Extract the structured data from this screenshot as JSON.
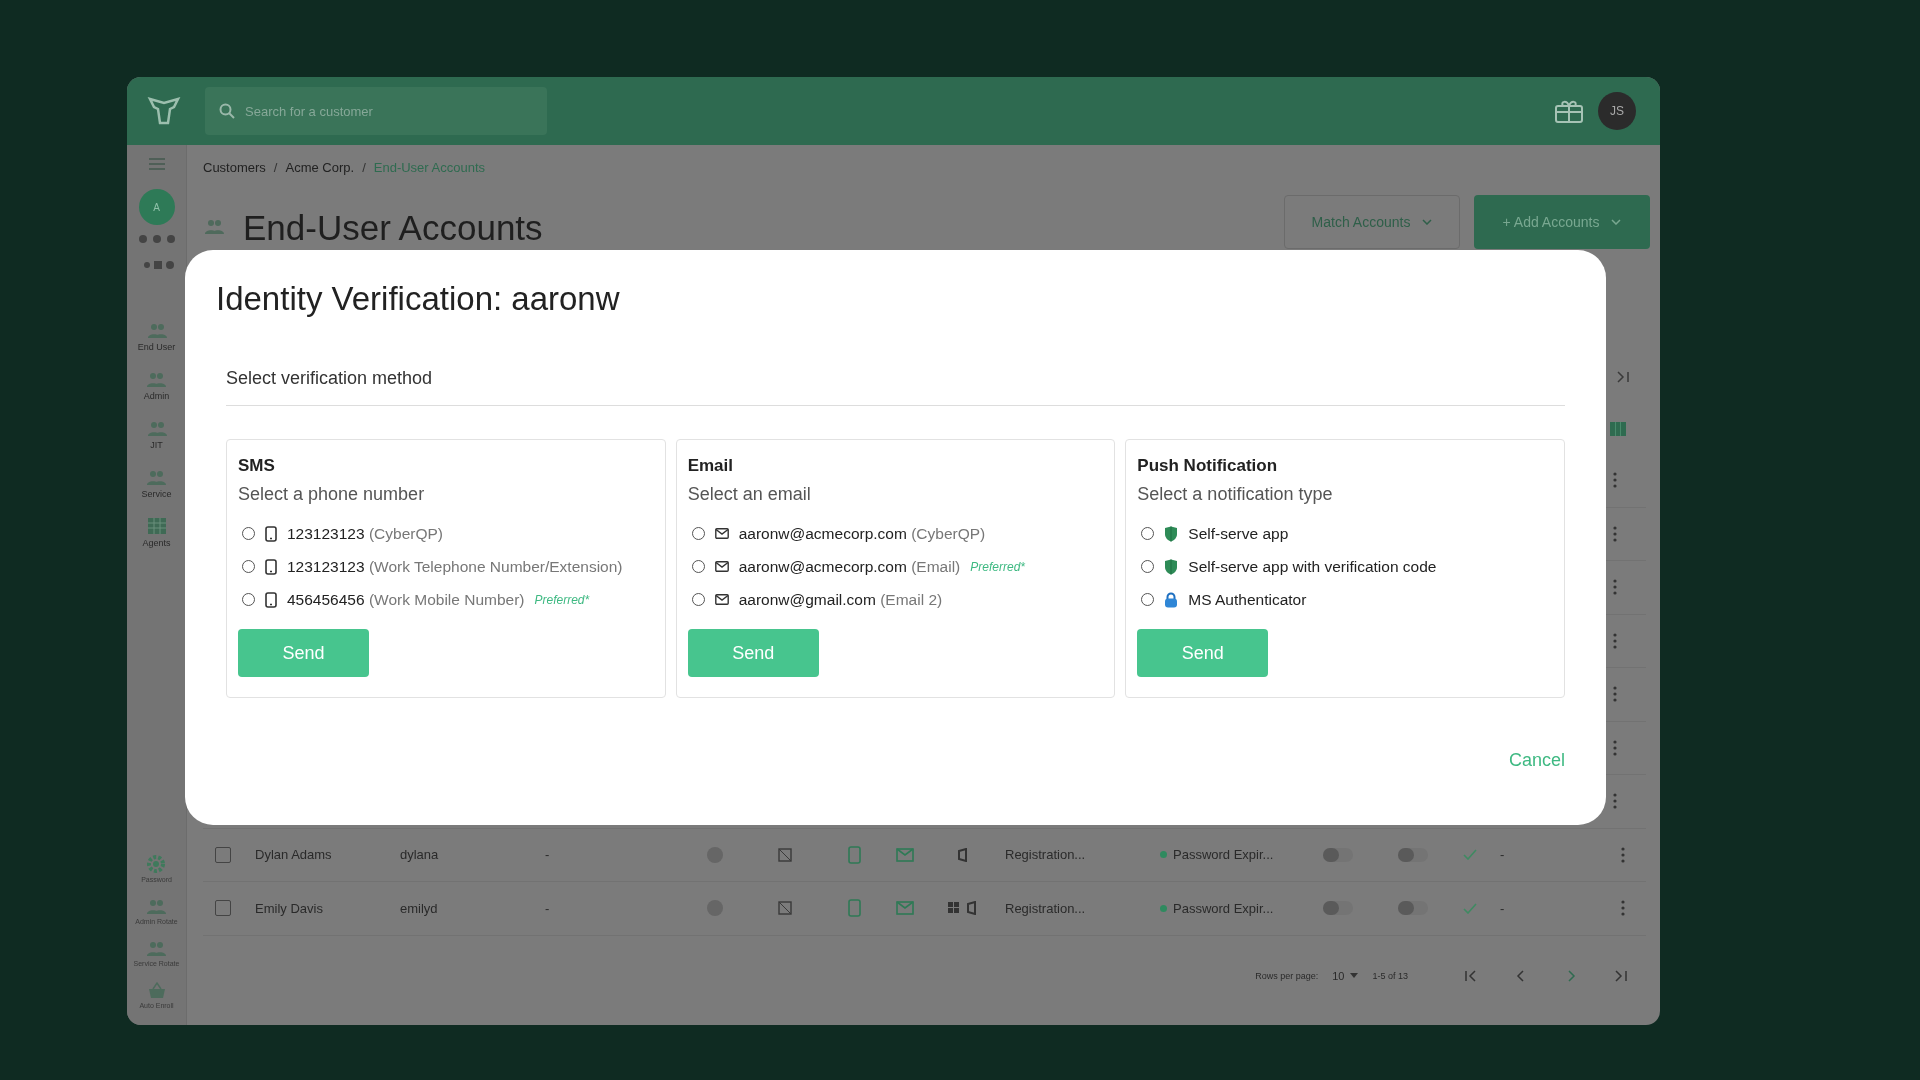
{
  "header": {
    "search": {
      "placeholder": "Search for a customer"
    },
    "avatar": "JS"
  },
  "sidebar": {
    "avatar": "A",
    "items": [
      {
        "label": "End User",
        "kind": "users"
      },
      {
        "label": "Admin",
        "kind": "users"
      },
      {
        "label": "JIT",
        "kind": "users"
      },
      {
        "label": "Service",
        "kind": "users"
      },
      {
        "label": "Agents",
        "kind": "grid"
      }
    ],
    "bottom_items": [
      {
        "label": "Password",
        "kind": "gear"
      },
      {
        "label": "Admin Rotate",
        "kind": "users"
      },
      {
        "label": "Service Rotate",
        "kind": "users"
      },
      {
        "label": "Auto Enroll",
        "kind": "basket"
      }
    ]
  },
  "breadcrumbs": [
    {
      "label": "Customers",
      "current": false
    },
    {
      "separator": "/",
      "label": "Acme Corp.",
      "current": false
    },
    {
      "separator": "/",
      "label": "End-User Accounts",
      "current": true
    }
  ],
  "page_title": "End-User Accounts",
  "actions": [
    {
      "label": "Match Accounts",
      "kind": "outline"
    },
    {
      "label": "+ Add Accounts",
      "kind": "primary"
    }
  ],
  "table": {
    "rows": [
      {
        "checked": false,
        "name": "Dylan Adams",
        "username": "dylana",
        "column_3": "-",
        "windows": false,
        "registration": "Registration...",
        "status": {
          "label": "Password Expir...",
          "color": "#2f8a5f"
        },
        "toggles": [
          {
            "on": false
          },
          {
            "on": false
          }
        ],
        "verified": true,
        "column_16": "-"
      },
      {
        "checked": false,
        "name": "Emily Davis",
        "username": "emilyd",
        "column_3": "-",
        "windows": true,
        "registration": "Registration...",
        "status": {
          "label": "Password Expir...",
          "color": "#2f8a5f"
        },
        "toggles": [
          {
            "on": false
          },
          {
            "on": false
          }
        ],
        "verified": true,
        "column_16": "-"
      }
    ]
  },
  "pagination": {
    "rows_per_page_label": "Rows per page:",
    "rows_per_page": "10",
    "range": "1-5 of 13"
  },
  "modal": {
    "title": "Identity Verification: aaronw",
    "subtitle": "Select verification method",
    "methods": [
      {
        "title": "SMS",
        "prompt": "Select a phone number",
        "button": "Send",
        "options": [
          {
            "kind": "phone",
            "value": "123123123",
            "source": "(CyberQP)",
            "selected": false
          },
          {
            "kind": "phone",
            "value": "123123123",
            "source": "(Work Telephone Number/Extension)",
            "selected": false
          },
          {
            "kind": "phone",
            "value": "456456456",
            "source": "(Work Mobile Number)",
            "badge": "Preferred*",
            "selected": false
          }
        ]
      },
      {
        "title": "Email",
        "prompt": "Select an email",
        "button": "Send",
        "options": [
          {
            "kind": "email",
            "value": "aaronw@acmecorp.com",
            "source": "(CyberQP)",
            "selected": false
          },
          {
            "kind": "email",
            "value": "aaronw@acmecorp.com",
            "source": "(Email)",
            "badge": "Preferred*",
            "selected": false
          },
          {
            "kind": "email",
            "value": "aaronw@gmail.com",
            "source": "(Email 2)",
            "selected": false
          }
        ]
      },
      {
        "title": "Push Notification",
        "prompt": "Select a notification type",
        "button": "Send",
        "options": [
          {
            "kind": "shield",
            "value": "Self-serve app",
            "selected": false
          },
          {
            "kind": "shield",
            "value": "Self-serve app with verification code",
            "selected": false
          },
          {
            "kind": "lock",
            "value": "MS Authenticator",
            "selected": false
          }
        ]
      }
    ],
    "cancel": "Cancel"
  }
}
